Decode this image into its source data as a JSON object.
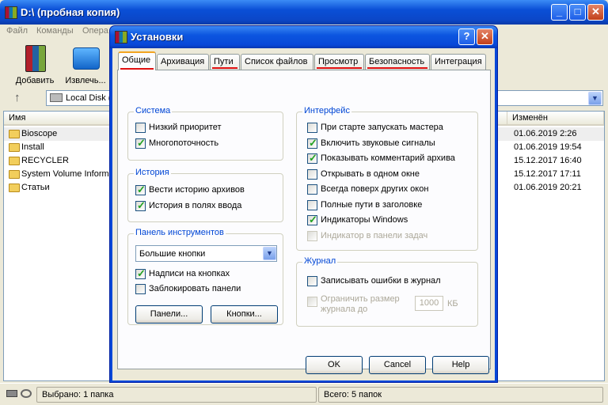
{
  "main": {
    "title": "D:\\ (пробная копия)",
    "menu": [
      "Файл",
      "Команды",
      "Опера"
    ],
    "toolbar": {
      "add": "Добавить",
      "extract": "Извлечь..."
    },
    "address": "Local Disk (D",
    "up_arrow": "↑",
    "columns": {
      "name": "Имя",
      "modified": "Изменён"
    },
    "files": [
      {
        "name": "Bioscope",
        "date": "01.06.2019 2:26"
      },
      {
        "name": "Install",
        "date": "01.06.2019 19:54"
      },
      {
        "name": "RECYCLER",
        "date": "15.12.2017 16:40"
      },
      {
        "name": "System Volume Informa",
        "date": "15.12.2017 17:11"
      },
      {
        "name": "Статьи",
        "date": "01.06.2019 20:21"
      }
    ],
    "status": {
      "selected": "Выбрано: 1 папка",
      "total": "Всего: 5 папок"
    }
  },
  "dialog": {
    "title": "Установки",
    "help_glyph": "?",
    "close_glyph": "✕",
    "tabs": [
      "Общие",
      "Архивация",
      "Пути",
      "Список файлов",
      "Просмотр",
      "Безопасность",
      "Интеграция"
    ],
    "selected_tab": "Общие",
    "system": {
      "title": "Система",
      "items": [
        {
          "label": "Низкий приоритет",
          "checked": false
        },
        {
          "label": "Многопоточность",
          "checked": true
        }
      ]
    },
    "history": {
      "title": "История",
      "items": [
        {
          "label": "Вести историю архивов",
          "checked": true
        },
        {
          "label": "История в полях ввода",
          "checked": true
        }
      ]
    },
    "toolbar_group": {
      "title": "Панель инструментов",
      "select_value": "Большие кнопки",
      "items": [
        {
          "label": "Надписи на кнопках",
          "checked": true
        },
        {
          "label": "Заблокировать панели",
          "checked": false
        }
      ],
      "panels_button": "Панели...",
      "buttons_button": "Кнопки..."
    },
    "interface": {
      "title": "Интерфейс",
      "items": [
        {
          "label": "При старте запускать мастера",
          "checked": false,
          "disabled": false
        },
        {
          "label": "Включить звуковые сигналы",
          "checked": true,
          "disabled": false
        },
        {
          "label": "Показывать комментарий архива",
          "checked": true,
          "disabled": false
        },
        {
          "label": "Открывать в одном окне",
          "checked": false,
          "disabled": false
        },
        {
          "label": "Всегда поверх других окон",
          "checked": false,
          "disabled": false
        },
        {
          "label": "Полные пути в заголовке",
          "checked": false,
          "disabled": false
        },
        {
          "label": "Индикаторы Windows",
          "checked": true,
          "disabled": false
        },
        {
          "label": "Индикатор в панели задач",
          "checked": false,
          "disabled": true
        }
      ]
    },
    "log": {
      "title": "Журнал",
      "write_errors": {
        "label": "Записывать ошибки в журнал",
        "checked": false
      },
      "limit_size_line1": "Ограничить размер",
      "limit_size_line2": "журнала до",
      "limit_size_checked": false,
      "size_value": "1000",
      "size_unit": "КБ"
    },
    "buttons": {
      "ok": "OK",
      "cancel": "Cancel",
      "help": "Help"
    }
  }
}
